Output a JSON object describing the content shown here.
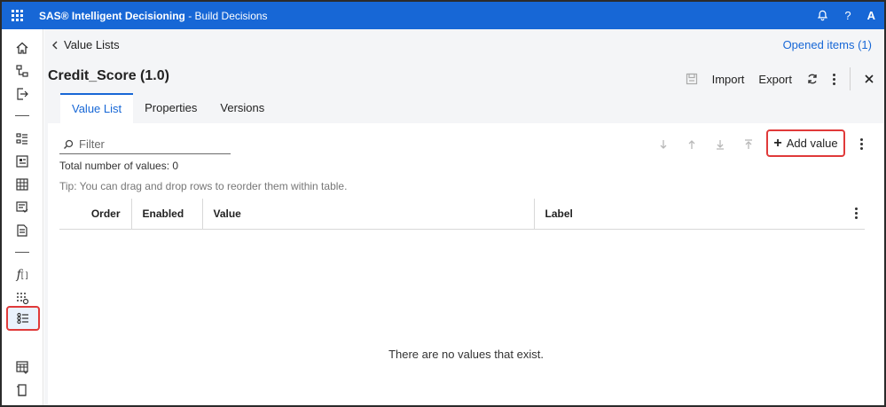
{
  "app": {
    "title_brand": "SAS® Intelligent Decisioning",
    "title_suffix": " - Build Decisions",
    "help_label": "?",
    "user_initial": "A"
  },
  "breadcrumb": {
    "back_label": "Value Lists",
    "opened_items": "Opened items (1)"
  },
  "document": {
    "title": "Credit_Score (1.0)",
    "import_label": "Import",
    "export_label": "Export"
  },
  "tabs": [
    {
      "label": "Value List",
      "active": true
    },
    {
      "label": "Properties",
      "active": false
    },
    {
      "label": "Versions",
      "active": false
    }
  ],
  "toolbar": {
    "filter_placeholder": "Filter",
    "add_value_label": "Add value"
  },
  "info": {
    "total": "Total number of values: 0",
    "tip": "Tip: You can drag and drop rows to reorder them within table."
  },
  "table": {
    "columns": [
      "Order",
      "Enabled",
      "Value",
      "Label"
    ],
    "rows": [],
    "empty_message": "There are no values that exist."
  },
  "rail": {
    "items": [
      "home-icon",
      "decisions-icon",
      "export-icon",
      "rule-sets-icon",
      "models-icon",
      "lookup-table-icon",
      "code-files-icon",
      "treatments-icon",
      "functions-icon",
      "data-grid-icon",
      "value-lists-icon",
      "tables-icon",
      "library-icon"
    ],
    "active": "value-lists-icon"
  },
  "colors": {
    "topbar": "#1767d6",
    "accent": "#1767d6",
    "highlight": "#e03a3a"
  }
}
